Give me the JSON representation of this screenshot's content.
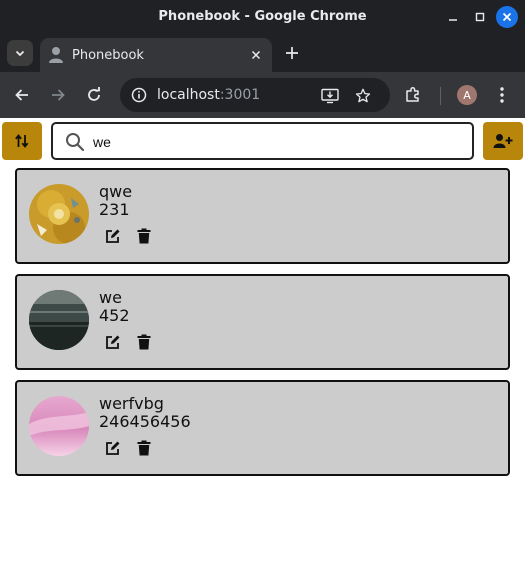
{
  "window": {
    "title": "Phonebook - Google Chrome"
  },
  "tab": {
    "title": "Phonebook"
  },
  "address_bar": {
    "host": "localhost",
    "port": ":3001"
  },
  "profile": {
    "initial": "A"
  },
  "search": {
    "value": "we",
    "icon": "search-icon"
  },
  "buttons": {
    "sort_icon": "sort-arrows-icon",
    "add_icon": "add-user-icon"
  },
  "colors": {
    "accent": "#b8860b",
    "card_bg": "#cccccc",
    "chrome_dark": "#202124",
    "chrome_toolbar": "#35363a",
    "close_blue": "#1a73e8"
  },
  "contacts": [
    {
      "name": "qwe",
      "number": "231",
      "avatar": "yellow-donut-photo"
    },
    {
      "name": "we",
      "number": "452",
      "avatar": "dark-green-photo"
    },
    {
      "name": "werfvbg",
      "number": "246456456",
      "avatar": "pink-gradient-photo"
    }
  ]
}
